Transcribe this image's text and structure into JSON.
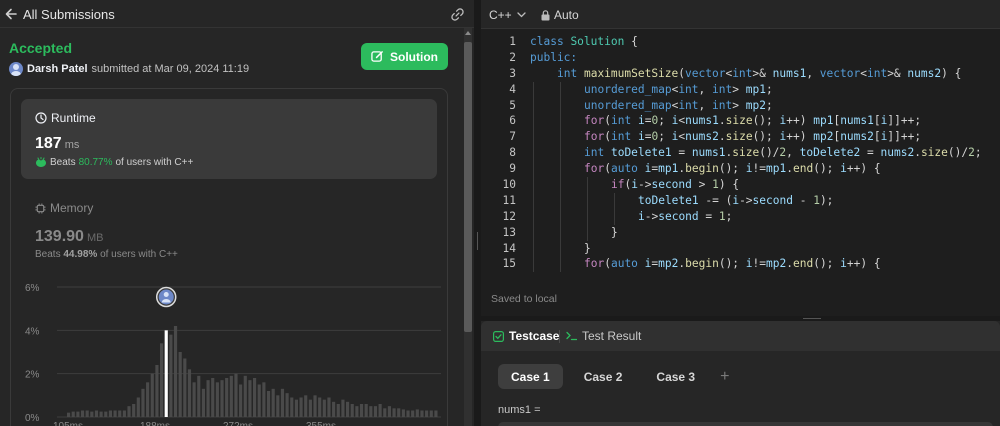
{
  "left_header": {
    "title": "All Submissions"
  },
  "submission": {
    "status": "Accepted",
    "user": "Darsh Patel",
    "submitted_at": "submitted at Mar 09, 2024 11:19",
    "solution_label": "Solution"
  },
  "runtime": {
    "label": "Runtime",
    "value": "187",
    "unit": "ms",
    "beats_prefix": "Beats",
    "beats_pct": "80.77%",
    "beats_suffix": "of users with C++"
  },
  "memory": {
    "label": "Memory",
    "value": "139.90",
    "unit": "MB",
    "beats_prefix": "Beats",
    "beats_pct": "44.98%",
    "beats_suffix": "of users with C++"
  },
  "chart_data": {
    "type": "bar",
    "title": "",
    "xlabel": "",
    "ylabel": "",
    "y_ticks": [
      "6%",
      "4%",
      "2%",
      "0%"
    ],
    "x_ticks": [
      "105ms",
      "188ms",
      "272ms",
      "355ms"
    ],
    "ylim": [
      0,
      6
    ],
    "highlight_index": 21,
    "values": [
      0.2,
      0.25,
      0.25,
      0.3,
      0.3,
      0.25,
      0.3,
      0.25,
      0.25,
      0.3,
      0.3,
      0.3,
      0.3,
      0.5,
      0.6,
      0.9,
      1.3,
      1.6,
      2.0,
      2.4,
      3.4,
      4.0,
      3.8,
      4.2,
      3.0,
      2.7,
      2.2,
      1.6,
      1.9,
      1.3,
      1.7,
      1.8,
      1.6,
      1.7,
      1.8,
      1.9,
      2.0,
      1.5,
      1.9,
      1.7,
      1.8,
      1.5,
      1.6,
      1.2,
      1.3,
      1.0,
      1.3,
      1.1,
      0.9,
      0.8,
      0.9,
      1.0,
      0.8,
      1.0,
      0.9,
      0.8,
      0.9,
      0.7,
      0.6,
      0.8,
      0.7,
      0.6,
      0.5,
      0.6,
      0.6,
      0.5,
      0.5,
      0.6,
      0.4,
      0.5,
      0.4,
      0.4,
      0.35,
      0.3,
      0.3,
      0.35,
      0.3,
      0.3,
      0.3,
      0.3
    ]
  },
  "editor": {
    "language": "C++",
    "mode": "Auto",
    "saved_text": "Saved to local"
  },
  "code_lines": [
    {
      "n": "1"
    },
    {
      "n": "2"
    },
    {
      "n": "3"
    },
    {
      "n": "4"
    },
    {
      "n": "5"
    },
    {
      "n": "6"
    },
    {
      "n": "7"
    },
    {
      "n": "8"
    },
    {
      "n": "9"
    },
    {
      "n": "10"
    },
    {
      "n": "11"
    },
    {
      "n": "12"
    },
    {
      "n": "13"
    },
    {
      "n": "14"
    },
    {
      "n": "15"
    }
  ],
  "code": {
    "l1": [
      "class",
      " ",
      "Solution",
      " {"
    ],
    "l2": [
      "public:"
    ],
    "l3": [
      "int",
      " ",
      "maximumSetSize",
      "(",
      "vector",
      "<",
      "int",
      ">& ",
      "nums1",
      ", ",
      "vector",
      "<",
      "int",
      ">& ",
      "nums2",
      ") {"
    ],
    "l4": [
      "unordered_map",
      "<",
      "int",
      ", ",
      "int",
      "> ",
      "mp1",
      ";"
    ],
    "l5": [
      "unordered_map",
      "<",
      "int",
      ", ",
      "int",
      "> ",
      "mp2",
      ";"
    ],
    "l6": [
      "for",
      "(",
      "int",
      " ",
      "i",
      "=",
      "0",
      "; ",
      "i",
      "<",
      "nums1",
      ".",
      "size",
      "(); ",
      "i",
      "++) ",
      "mp1",
      "[",
      "nums1",
      "[",
      "i",
      "]]++;"
    ],
    "l7": [
      "for",
      "(",
      "int",
      " ",
      "i",
      "=",
      "0",
      "; ",
      "i",
      "<",
      "nums2",
      ".",
      "size",
      "(); ",
      "i",
      "++) ",
      "mp2",
      "[",
      "nums2",
      "[",
      "i",
      "]]++;"
    ],
    "l8": [
      "int",
      " ",
      "toDelete1",
      " = ",
      "nums1",
      ".",
      "size",
      "()/",
      "2",
      ", ",
      "toDelete2",
      " = ",
      "nums2",
      ".",
      "size",
      "()/",
      "2",
      ";"
    ],
    "l9": [
      "for",
      "(",
      "auto",
      " ",
      "i",
      "=",
      "mp1",
      ".",
      "begin",
      "(); ",
      "i",
      "!=",
      "mp1",
      ".",
      "end",
      "(); ",
      "i",
      "++) {"
    ],
    "l10": [
      "if",
      "(",
      "i",
      "->",
      "second",
      " > ",
      "1",
      ") {"
    ],
    "l11": [
      "toDelete1",
      " -= (",
      "i",
      "->",
      "second",
      " - ",
      "1",
      ");"
    ],
    "l12": [
      "i",
      "->",
      "second",
      " = ",
      "1",
      ";"
    ],
    "l13": [
      "}"
    ],
    "l14": [
      "}"
    ],
    "l15": [
      "for",
      "(",
      "auto",
      " ",
      "i",
      "=",
      "mp2",
      ".",
      "begin",
      "(); ",
      "i",
      "!=",
      "mp2",
      ".",
      "end",
      "(); ",
      "i",
      "++) {"
    ]
  },
  "testcase": {
    "tab_testcase": "Testcase",
    "tab_result": "Test Result",
    "cases": [
      "Case 1",
      "Case 2",
      "Case 3"
    ],
    "add": "+",
    "nums1_label": "nums1 ="
  },
  "colors": {
    "accent_green": "#2cbb5d",
    "bg_panel": "#262626",
    "bg_editor": "#1e1e1e"
  }
}
